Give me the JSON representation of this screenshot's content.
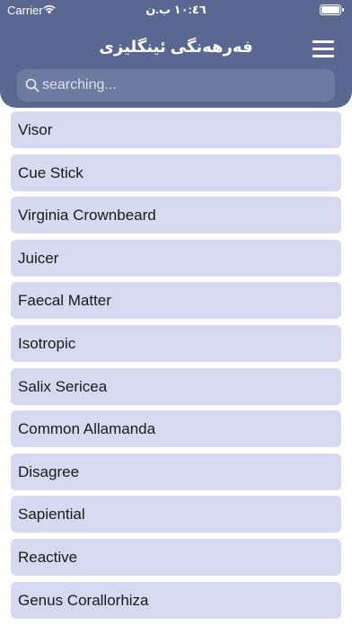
{
  "status_bar": {
    "carrier": "Carrier",
    "time": "١٠:٤٦ ب.ن"
  },
  "header": {
    "title": "فەرهەنگی ئینگلیزی"
  },
  "search": {
    "placeholder": "searching..."
  },
  "colors": {
    "header_bg": "#5a6790",
    "search_bg": "#6e7aa0",
    "item_bg": "#d6d9ef"
  },
  "words": [
    "Visor",
    "Cue Stick",
    "Virginia Crownbeard",
    "Juicer",
    "Faecal Matter",
    "Isotropic",
    "Salix Sericea",
    "Common Allamanda",
    "Disagree",
    "Sapiential",
    "Reactive",
    "Genus Corallorhiza"
  ]
}
